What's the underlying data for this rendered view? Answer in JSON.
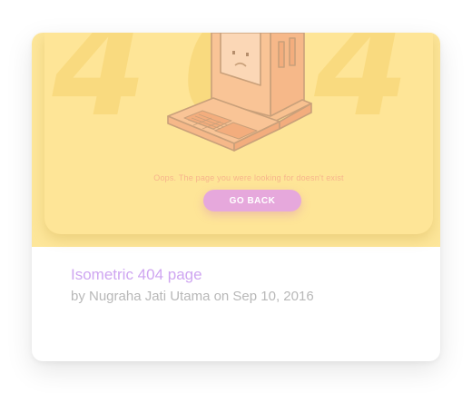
{
  "preview": {
    "bg_text": "404",
    "message": "Oops. The page you were looking for doesn't exist",
    "button_label": "GO BACK"
  },
  "card": {
    "title": "Isometric 404 page",
    "byline": "by Nugraha Jati Utama on Sep 10, 2016"
  },
  "colors": {
    "preview_bg": "#fde69a",
    "button": "#e6a8dc",
    "title": "#cfa6f1",
    "byline": "#b8b8b8",
    "computer": "#f8bf8d"
  }
}
